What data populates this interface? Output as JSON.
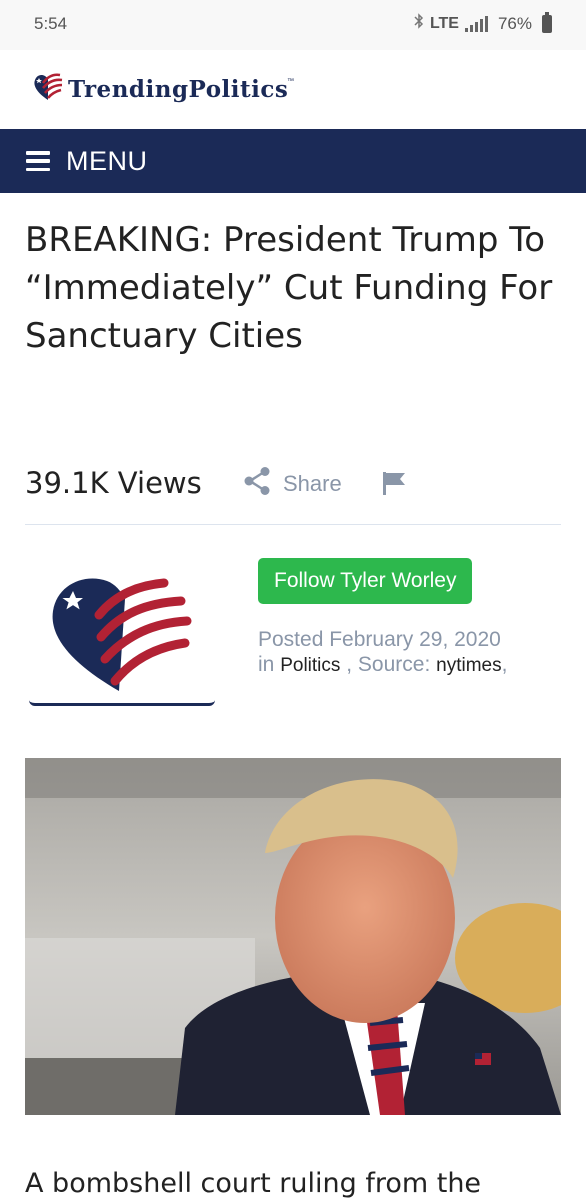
{
  "status": {
    "time": "5:54",
    "network": "LTE",
    "battery": "76%"
  },
  "brand": {
    "name": "TrendingPolitics",
    "tm": "™",
    "logo_icon": "heart-flag-logo"
  },
  "menu": {
    "label": "MENU",
    "icon": "hamburger-icon"
  },
  "article": {
    "headline": "BREAKING: President Trump To “Immediately” Cut Funding For Sanctuary Cities",
    "views": "39.1K Views",
    "share_label": "Share",
    "share_icon": "share-icon",
    "flag_icon": "flag-icon",
    "follow_label": "Follow Tyler Worley",
    "posted_prefix": "Posted",
    "posted_date": "February 29, 2020",
    "in_label": "in",
    "category": "Politics",
    "source_label": ", Source:",
    "source": "nytimes",
    "source_trailing": ",",
    "body_start": "A bombshell court ruling from the"
  },
  "colors": {
    "navy": "#1b2a57",
    "follow_green": "#2db84d",
    "muted_text": "#8a96a8",
    "flag_red": "#b22234"
  }
}
